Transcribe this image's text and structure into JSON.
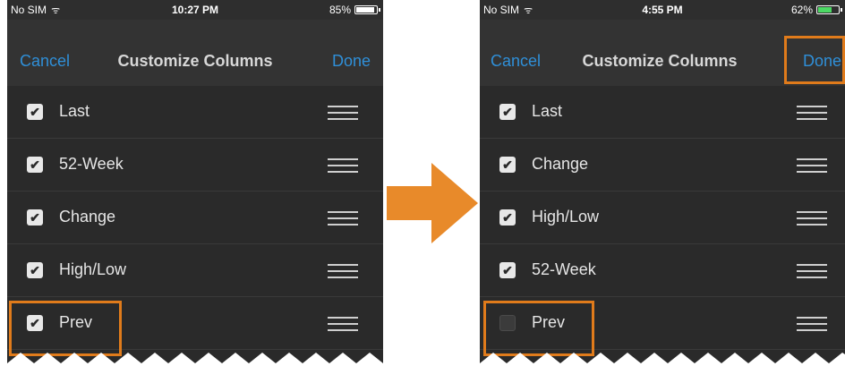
{
  "left_screen": {
    "status": {
      "carrier": "No SIM",
      "time": "10:27 PM",
      "battery": "85%",
      "battery_level": 0.85
    },
    "nav": {
      "cancel": "Cancel",
      "title": "Customize Columns",
      "done": "Done"
    },
    "rows": [
      {
        "label": "Last",
        "checked": true
      },
      {
        "label": "52-Week",
        "checked": true
      },
      {
        "label": "Change",
        "checked": true
      },
      {
        "label": "High/Low",
        "checked": true
      },
      {
        "label": "Prev",
        "checked": true
      }
    ]
  },
  "right_screen": {
    "status": {
      "carrier": "No SIM",
      "time": "4:55 PM",
      "battery": "62%",
      "battery_level": 0.62
    },
    "nav": {
      "cancel": "Cancel",
      "title": "Customize Columns",
      "done": "Done"
    },
    "rows": [
      {
        "label": "Last",
        "checked": true
      },
      {
        "label": "Change",
        "checked": true
      },
      {
        "label": "High/Low",
        "checked": true
      },
      {
        "label": "52-Week",
        "checked": true
      },
      {
        "label": "Prev",
        "checked": false
      }
    ]
  },
  "colors": {
    "accent": "#2f8fd8",
    "highlight": "#e07b1b",
    "background": "#2a2a2a"
  },
  "icons": {
    "wifi": "wifi-icon",
    "checkbox": "checkbox-icon",
    "drag": "drag-handle-icon",
    "arrow": "right-arrow-icon"
  }
}
